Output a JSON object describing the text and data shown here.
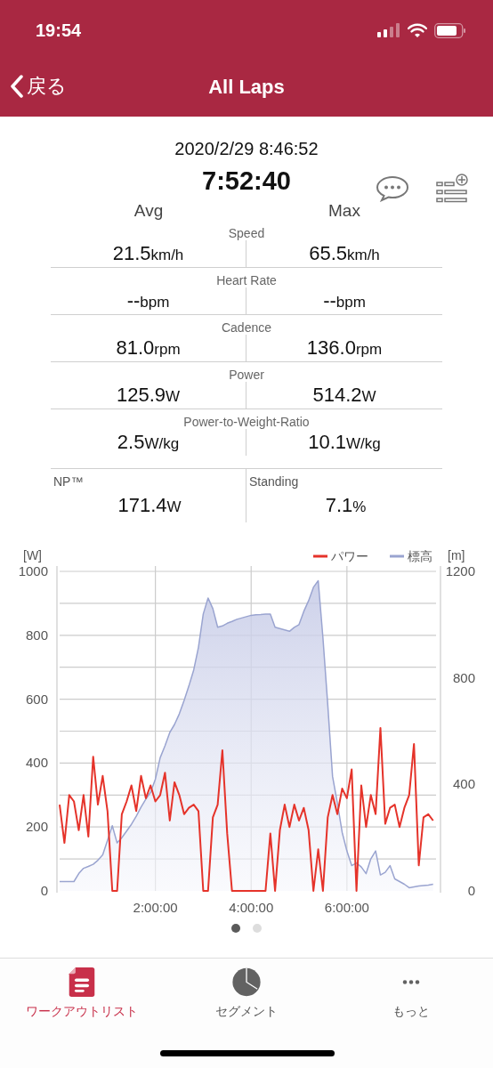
{
  "status_bar": {
    "time": "19:54"
  },
  "nav": {
    "back": "戻る",
    "title": "All Laps"
  },
  "summary": {
    "date": "2020/2/29 8:46:52",
    "duration": "7:52:40",
    "columns": [
      "Avg",
      "Max"
    ]
  },
  "metrics": [
    {
      "kind": "pair",
      "label": "Speed",
      "avg": {
        "value": "21.5",
        "unit": "km/h"
      },
      "max": {
        "value": "65.5",
        "unit": "km/h"
      }
    },
    {
      "kind": "pair",
      "label": "Heart Rate",
      "avg": {
        "value": "--",
        "unit": "bpm"
      },
      "max": {
        "value": "--",
        "unit": "bpm"
      }
    },
    {
      "kind": "pair",
      "label": "Cadence",
      "avg": {
        "value": "81.0",
        "unit": "rpm"
      },
      "max": {
        "value": "136.0",
        "unit": "rpm"
      }
    },
    {
      "kind": "pair",
      "label": "Power",
      "avg": {
        "value": "125.9",
        "unit": "W"
      },
      "max": {
        "value": "514.2",
        "unit": "W"
      }
    },
    {
      "kind": "pair",
      "label": "Power-to-Weight-Ratio",
      "avg": {
        "value": "2.5",
        "unit": "W/kg"
      },
      "max": {
        "value": "10.1",
        "unit": "W/kg"
      }
    },
    {
      "kind": "split",
      "cells": [
        {
          "label": "NP™",
          "value": "171.4",
          "unit": "W"
        },
        {
          "label": "Standing",
          "value": "7.1",
          "unit": "%"
        }
      ]
    }
  ],
  "chart": {
    "chart_data": {
      "type": "line",
      "ylabel": "[W]",
      "y2label": "[m]",
      "x": [
        0,
        0.1,
        0.2,
        0.3,
        0.4,
        0.5,
        0.6,
        0.7,
        0.8,
        0.9,
        1,
        1.1,
        1.2,
        1.3,
        1.4,
        1.5,
        1.6,
        1.7,
        1.8,
        1.9,
        2,
        2.1,
        2.2,
        2.3,
        2.4,
        2.5,
        2.6,
        2.7,
        2.8,
        2.9,
        3,
        3.1,
        3.2,
        3.3,
        3.4,
        3.5,
        3.6,
        3.7,
        3.8,
        3.9,
        4,
        4.1,
        4.2,
        4.3,
        4.4,
        4.5,
        4.6,
        4.7,
        4.8,
        4.9,
        5,
        5.1,
        5.2,
        5.3,
        5.4,
        5.5,
        5.6,
        5.7,
        5.8,
        5.9,
        6,
        6.1,
        6.2,
        6.3,
        6.4,
        6.5,
        6.6,
        6.7,
        6.8,
        6.9,
        7,
        7.1,
        7.2,
        7.3,
        7.4,
        7.5,
        7.6,
        7.7,
        7.8
      ],
      "series": [
        {
          "name": "パワー",
          "color": "#e5332a",
          "axis": "y",
          "type": "line",
          "values": [
            270,
            150,
            300,
            280,
            190,
            300,
            170,
            420,
            270,
            360,
            250,
            0,
            0,
            240,
            280,
            330,
            250,
            360,
            290,
            330,
            280,
            300,
            370,
            220,
            340,
            300,
            240,
            260,
            270,
            250,
            0,
            0,
            230,
            270,
            440,
            180,
            0,
            0,
            0,
            0,
            0,
            0,
            0,
            0,
            180,
            0,
            190,
            270,
            200,
            270,
            220,
            260,
            190,
            0,
            130,
            0,
            230,
            300,
            240,
            320,
            290,
            380,
            0,
            330,
            200,
            300,
            240,
            510,
            210,
            260,
            270,
            200,
            260,
            300,
            460,
            80,
            230,
            240,
            220
          ]
        },
        {
          "name": "標高",
          "color": "#9aa4d0",
          "axis": "y2",
          "type": "area",
          "values": [
            35,
            35,
            35,
            35,
            65,
            85,
            92,
            100,
            115,
            135,
            190,
            245,
            180,
            200,
            225,
            250,
            280,
            315,
            345,
            370,
            420,
            500,
            545,
            595,
            625,
            665,
            715,
            770,
            830,
            915,
            1040,
            1100,
            1060,
            990,
            995,
            1005,
            1012,
            1020,
            1025,
            1030,
            1035,
            1037,
            1038,
            1040,
            1040,
            990,
            985,
            980,
            975,
            990,
            1000,
            1050,
            1090,
            1140,
            1165,
            950,
            700,
            430,
            330,
            220,
            150,
            95,
            105,
            90,
            65,
            120,
            150,
            60,
            70,
            95,
            45,
            35,
            25,
            12,
            15,
            18,
            20,
            22,
            25
          ]
        }
      ],
      "grid": true,
      "legend": true,
      "xlim": [
        0,
        7.88
      ],
      "ylim": [
        0,
        1000
      ],
      "y2lim": [
        0,
        1200
      ],
      "yticks": [
        0,
        200,
        400,
        600,
        800,
        1000
      ],
      "y2ticks": [
        0,
        400,
        800,
        1200
      ],
      "xticks": [
        {
          "value": 2,
          "label": "2:00:00"
        },
        {
          "value": 4,
          "label": "4:00:00"
        },
        {
          "value": 6,
          "label": "6:00:00"
        }
      ]
    }
  },
  "pager": [
    {
      "selected": true
    },
    {
      "selected": false
    }
  ],
  "tabs": [
    {
      "label": "ワークアウトリスト",
      "kind": "list",
      "selected": true
    },
    {
      "label": "セグメント",
      "kind": "pie",
      "selected": false
    },
    {
      "label": "もっと",
      "kind": "more",
      "selected": false
    }
  ]
}
